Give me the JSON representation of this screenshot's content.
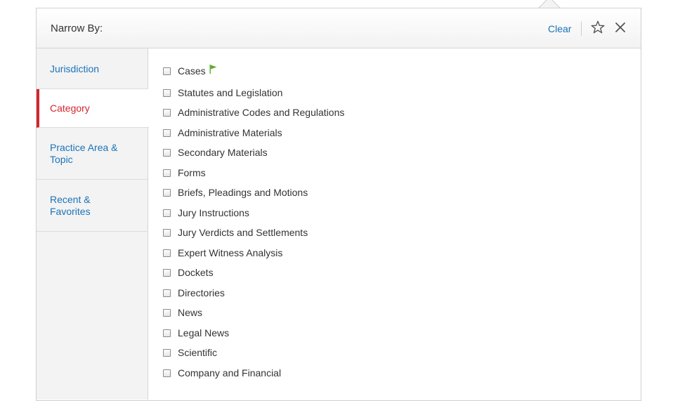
{
  "header": {
    "title": "Narrow By:",
    "clear_label": "Clear",
    "star_icon": "star-outline-icon",
    "close_icon": "close-icon"
  },
  "sidebar": {
    "items": [
      {
        "label": "Jurisdiction",
        "active": false
      },
      {
        "label": "Category",
        "active": true
      },
      {
        "label": "Practice Area & Topic",
        "active": false
      },
      {
        "label": "Recent & Favorites",
        "active": false
      }
    ]
  },
  "options": [
    {
      "label": "Cases",
      "checked": false,
      "flag": true
    },
    {
      "label": "Statutes and Legislation",
      "checked": false
    },
    {
      "label": "Administrative Codes and Regulations",
      "checked": false
    },
    {
      "label": "Administrative Materials",
      "checked": false
    },
    {
      "label": "Secondary Materials",
      "checked": false
    },
    {
      "label": "Forms",
      "checked": false
    },
    {
      "label": "Briefs, Pleadings and Motions",
      "checked": false
    },
    {
      "label": "Jury Instructions",
      "checked": false
    },
    {
      "label": "Jury Verdicts and Settlements",
      "checked": false
    },
    {
      "label": "Expert Witness Analysis",
      "checked": false
    },
    {
      "label": "Dockets",
      "checked": false
    },
    {
      "label": "Directories",
      "checked": false
    },
    {
      "label": "News",
      "checked": false
    },
    {
      "label": "Legal News",
      "checked": false
    },
    {
      "label": "Scientific",
      "checked": false
    },
    {
      "label": "Company and Financial",
      "checked": false
    }
  ],
  "colors": {
    "link": "#1a73b8",
    "active": "#d3262c",
    "flag": "#5fa832"
  }
}
